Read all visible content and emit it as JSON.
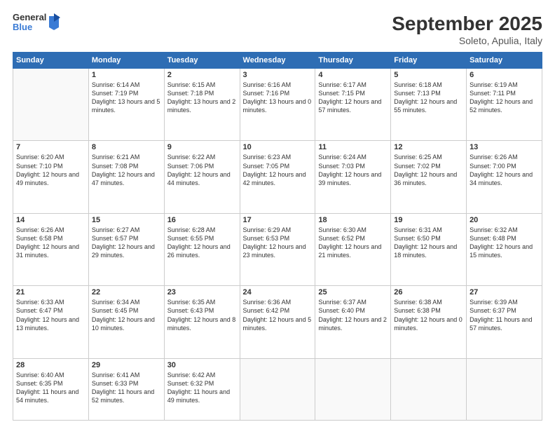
{
  "header": {
    "logo": {
      "general": "General",
      "blue": "Blue"
    },
    "title": "September 2025",
    "location": "Soleto, Apulia, Italy"
  },
  "calendar": {
    "days": [
      "Sunday",
      "Monday",
      "Tuesday",
      "Wednesday",
      "Thursday",
      "Friday",
      "Saturday"
    ],
    "weeks": [
      [
        {
          "day": "",
          "content": ""
        },
        {
          "day": "1",
          "content": "Sunrise: 6:14 AM\nSunset: 7:19 PM\nDaylight: 13 hours\nand 5 minutes."
        },
        {
          "day": "2",
          "content": "Sunrise: 6:15 AM\nSunset: 7:18 PM\nDaylight: 13 hours\nand 2 minutes."
        },
        {
          "day": "3",
          "content": "Sunrise: 6:16 AM\nSunset: 7:16 PM\nDaylight: 13 hours\nand 0 minutes."
        },
        {
          "day": "4",
          "content": "Sunrise: 6:17 AM\nSunset: 7:15 PM\nDaylight: 12 hours\nand 57 minutes."
        },
        {
          "day": "5",
          "content": "Sunrise: 6:18 AM\nSunset: 7:13 PM\nDaylight: 12 hours\nand 55 minutes."
        },
        {
          "day": "6",
          "content": "Sunrise: 6:19 AM\nSunset: 7:11 PM\nDaylight: 12 hours\nand 52 minutes."
        }
      ],
      [
        {
          "day": "7",
          "content": "Sunrise: 6:20 AM\nSunset: 7:10 PM\nDaylight: 12 hours\nand 49 minutes."
        },
        {
          "day": "8",
          "content": "Sunrise: 6:21 AM\nSunset: 7:08 PM\nDaylight: 12 hours\nand 47 minutes."
        },
        {
          "day": "9",
          "content": "Sunrise: 6:22 AM\nSunset: 7:06 PM\nDaylight: 12 hours\nand 44 minutes."
        },
        {
          "day": "10",
          "content": "Sunrise: 6:23 AM\nSunset: 7:05 PM\nDaylight: 12 hours\nand 42 minutes."
        },
        {
          "day": "11",
          "content": "Sunrise: 6:24 AM\nSunset: 7:03 PM\nDaylight: 12 hours\nand 39 minutes."
        },
        {
          "day": "12",
          "content": "Sunrise: 6:25 AM\nSunset: 7:02 PM\nDaylight: 12 hours\nand 36 minutes."
        },
        {
          "day": "13",
          "content": "Sunrise: 6:26 AM\nSunset: 7:00 PM\nDaylight: 12 hours\nand 34 minutes."
        }
      ],
      [
        {
          "day": "14",
          "content": "Sunrise: 6:26 AM\nSunset: 6:58 PM\nDaylight: 12 hours\nand 31 minutes."
        },
        {
          "day": "15",
          "content": "Sunrise: 6:27 AM\nSunset: 6:57 PM\nDaylight: 12 hours\nand 29 minutes."
        },
        {
          "day": "16",
          "content": "Sunrise: 6:28 AM\nSunset: 6:55 PM\nDaylight: 12 hours\nand 26 minutes."
        },
        {
          "day": "17",
          "content": "Sunrise: 6:29 AM\nSunset: 6:53 PM\nDaylight: 12 hours\nand 23 minutes."
        },
        {
          "day": "18",
          "content": "Sunrise: 6:30 AM\nSunset: 6:52 PM\nDaylight: 12 hours\nand 21 minutes."
        },
        {
          "day": "19",
          "content": "Sunrise: 6:31 AM\nSunset: 6:50 PM\nDaylight: 12 hours\nand 18 minutes."
        },
        {
          "day": "20",
          "content": "Sunrise: 6:32 AM\nSunset: 6:48 PM\nDaylight: 12 hours\nand 15 minutes."
        }
      ],
      [
        {
          "day": "21",
          "content": "Sunrise: 6:33 AM\nSunset: 6:47 PM\nDaylight: 12 hours\nand 13 minutes."
        },
        {
          "day": "22",
          "content": "Sunrise: 6:34 AM\nSunset: 6:45 PM\nDaylight: 12 hours\nand 10 minutes."
        },
        {
          "day": "23",
          "content": "Sunrise: 6:35 AM\nSunset: 6:43 PM\nDaylight: 12 hours\nand 8 minutes."
        },
        {
          "day": "24",
          "content": "Sunrise: 6:36 AM\nSunset: 6:42 PM\nDaylight: 12 hours\nand 5 minutes."
        },
        {
          "day": "25",
          "content": "Sunrise: 6:37 AM\nSunset: 6:40 PM\nDaylight: 12 hours\nand 2 minutes."
        },
        {
          "day": "26",
          "content": "Sunrise: 6:38 AM\nSunset: 6:38 PM\nDaylight: 12 hours\nand 0 minutes."
        },
        {
          "day": "27",
          "content": "Sunrise: 6:39 AM\nSunset: 6:37 PM\nDaylight: 11 hours\nand 57 minutes."
        }
      ],
      [
        {
          "day": "28",
          "content": "Sunrise: 6:40 AM\nSunset: 6:35 PM\nDaylight: 11 hours\nand 54 minutes."
        },
        {
          "day": "29",
          "content": "Sunrise: 6:41 AM\nSunset: 6:33 PM\nDaylight: 11 hours\nand 52 minutes."
        },
        {
          "day": "30",
          "content": "Sunrise: 6:42 AM\nSunset: 6:32 PM\nDaylight: 11 hours\nand 49 minutes."
        },
        {
          "day": "",
          "content": ""
        },
        {
          "day": "",
          "content": ""
        },
        {
          "day": "",
          "content": ""
        },
        {
          "day": "",
          "content": ""
        }
      ]
    ]
  }
}
